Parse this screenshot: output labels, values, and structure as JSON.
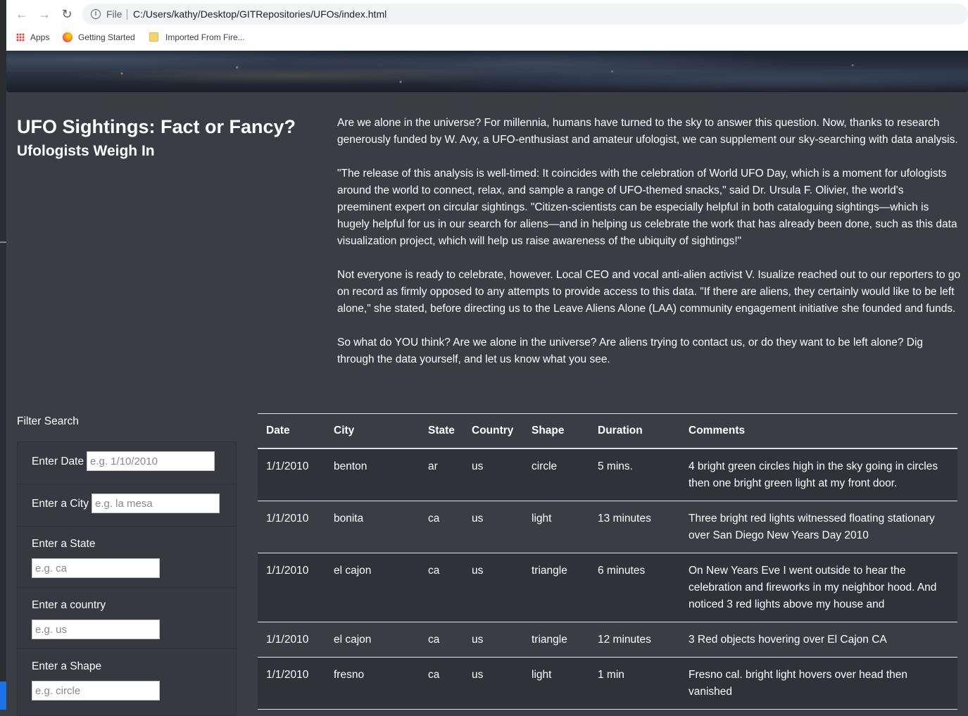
{
  "browser": {
    "file_label": "File",
    "url": "C:/Users/kathy/Desktop/GITRepositories/UFOs/index.html",
    "bookmarks": [
      {
        "label": "Apps",
        "icon": "apps-grid-icon"
      },
      {
        "label": "Getting Started",
        "icon": "firefox-icon"
      },
      {
        "label": "Imported From Fire...",
        "icon": "folder-icon"
      }
    ]
  },
  "header": {
    "title": "UFO Sightings: Fact or Fancy?",
    "subtitle": "Ufologists Weigh In"
  },
  "article": {
    "paragraphs": [
      "Are we alone in the universe? For millennia, humans have turned to the sky to answer this question. Now, thanks to research generously funded by W. Avy, a UFO-enthusiast and amateur ufologist, we can supplement our sky-searching with data analysis.",
      "\"The release of this analysis is well-timed: It coincides with the celebration of World UFO Day, which is a moment for ufologists around the world to connect, relax, and sample a range of UFO-themed snacks,\" said Dr. Ursula F. Olivier, the world's preeminent expert on circular sightings. \"Citizen-scientists can be especially helpful in both cataloguing sightings—which is hugely helpful for us in our search for aliens—and in helping us celebrate the work that has already been done, such as this data visualization project, which will help us raise awareness of the ubiquity of sightings!\"",
      "Not everyone is ready to celebrate, however. Local CEO and vocal anti-alien activist V. Isualize reached out to our reporters to go on record as firmly opposed to any attempts to provide access to this data. \"If there are aliens, they certainly would like to be left alone,\" she stated, before directing us to the Leave Aliens Alone (LAA) community engagement initiative she founded and funds.",
      "So what do YOU think? Are we alone in the universe? Are aliens trying to contact us, or do they want to be left alone? Dig through the data yourself, and let us know what you see."
    ]
  },
  "filters": {
    "title": "Filter Search",
    "items": [
      {
        "label": "Enter Date",
        "placeholder": "e.g. 1/10/2010"
      },
      {
        "label": "Enter a City",
        "placeholder": "e.g. la mesa"
      },
      {
        "label": "Enter a State",
        "placeholder": "e.g. ca"
      },
      {
        "label": "Enter a country",
        "placeholder": "e.g. us"
      },
      {
        "label": "Enter a Shape",
        "placeholder": "e.g. circle"
      }
    ]
  },
  "table": {
    "headers": [
      "Date",
      "City",
      "State",
      "Country",
      "Shape",
      "Duration",
      "Comments"
    ],
    "rows": [
      [
        "1/1/2010",
        "benton",
        "ar",
        "us",
        "circle",
        "5 mins.",
        "4 bright green circles high in the sky going in circles then one bright green light at my front door."
      ],
      [
        "1/1/2010",
        "bonita",
        "ca",
        "us",
        "light",
        "13 minutes",
        "Three bright red lights witnessed floating stationary over San Diego New Years Day 2010"
      ],
      [
        "1/1/2010",
        "el cajon",
        "ca",
        "us",
        "triangle",
        "6 minutes",
        "On New Years Eve I went outside to hear the celebration and fireworks in my neighbor hood. And noticed 3 red lights above my house and"
      ],
      [
        "1/1/2010",
        "el cajon",
        "ca",
        "us",
        "triangle",
        "12 minutes",
        "3 Red objects hovering over El Cajon CA"
      ],
      [
        "1/1/2010",
        "fresno",
        "ca",
        "us",
        "light",
        "1 min",
        "Fresno cal. bright light hovers over head then vanished"
      ]
    ]
  }
}
